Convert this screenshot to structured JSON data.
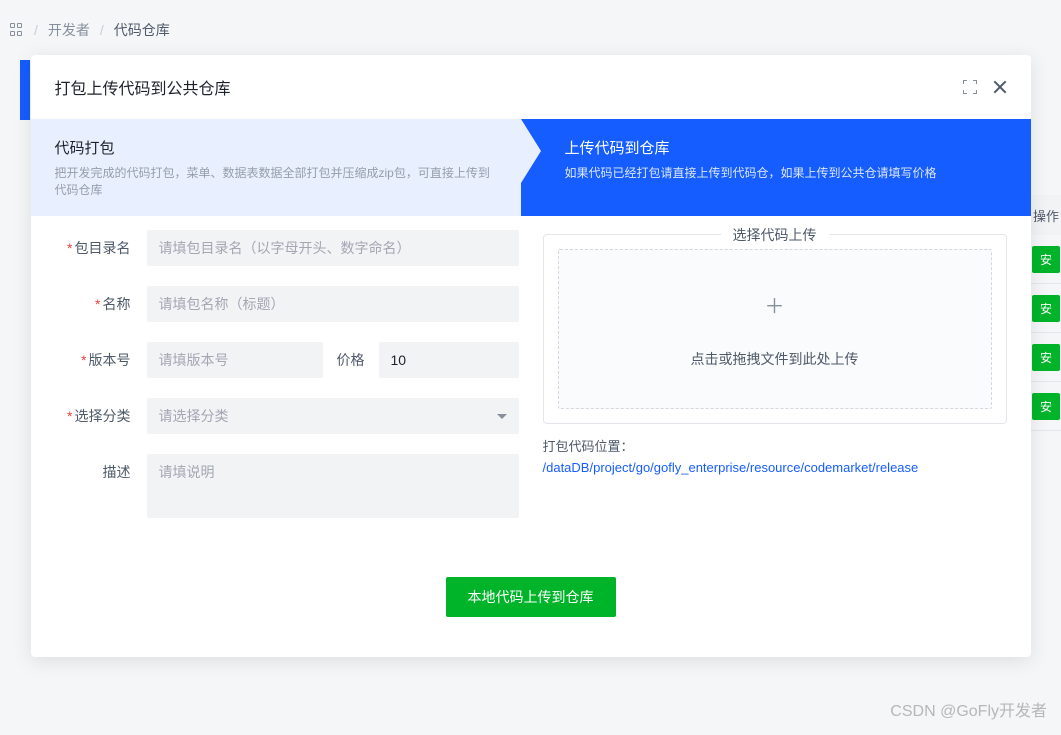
{
  "breadcrumb": {
    "item1": "开发者",
    "item2": "代码仓库"
  },
  "bg_table": {
    "header": "操作",
    "action": "安"
  },
  "modal": {
    "title": "打包上传代码到公共仓库",
    "steps": {
      "s1": {
        "title": "代码打包",
        "desc": "把开发完成的代码打包，菜单、数据表数据全部打包并压缩成zip包，可直接上传到代码仓库"
      },
      "s2": {
        "title": "上传代码到仓库",
        "desc": "如果代码已经打包请直接上传到代码仓，如果上传到公共仓请填写价格"
      }
    },
    "form": {
      "dir_label": "包目录名",
      "dir_placeholder": "请填包目录名（以字母开头、数字命名）",
      "name_label": "名称",
      "name_placeholder": "请填包名称（标题）",
      "version_label": "版本号",
      "version_placeholder": "请填版本号",
      "price_label": "价格",
      "price_value": "10",
      "category_label": "选择分类",
      "category_placeholder": "请选择分类",
      "desc_label": "描述",
      "desc_placeholder": "请填说明"
    },
    "upload": {
      "legend": "选择代码上传",
      "hint": "点击或拖拽文件到此处上传",
      "path_label": "打包代码位置：",
      "path_value": "/dataDB/project/go/gofly_enterprise/resource/codemarket/release"
    },
    "submit": "本地代码上传到仓库"
  },
  "watermark": "CSDN @GoFly开发者"
}
